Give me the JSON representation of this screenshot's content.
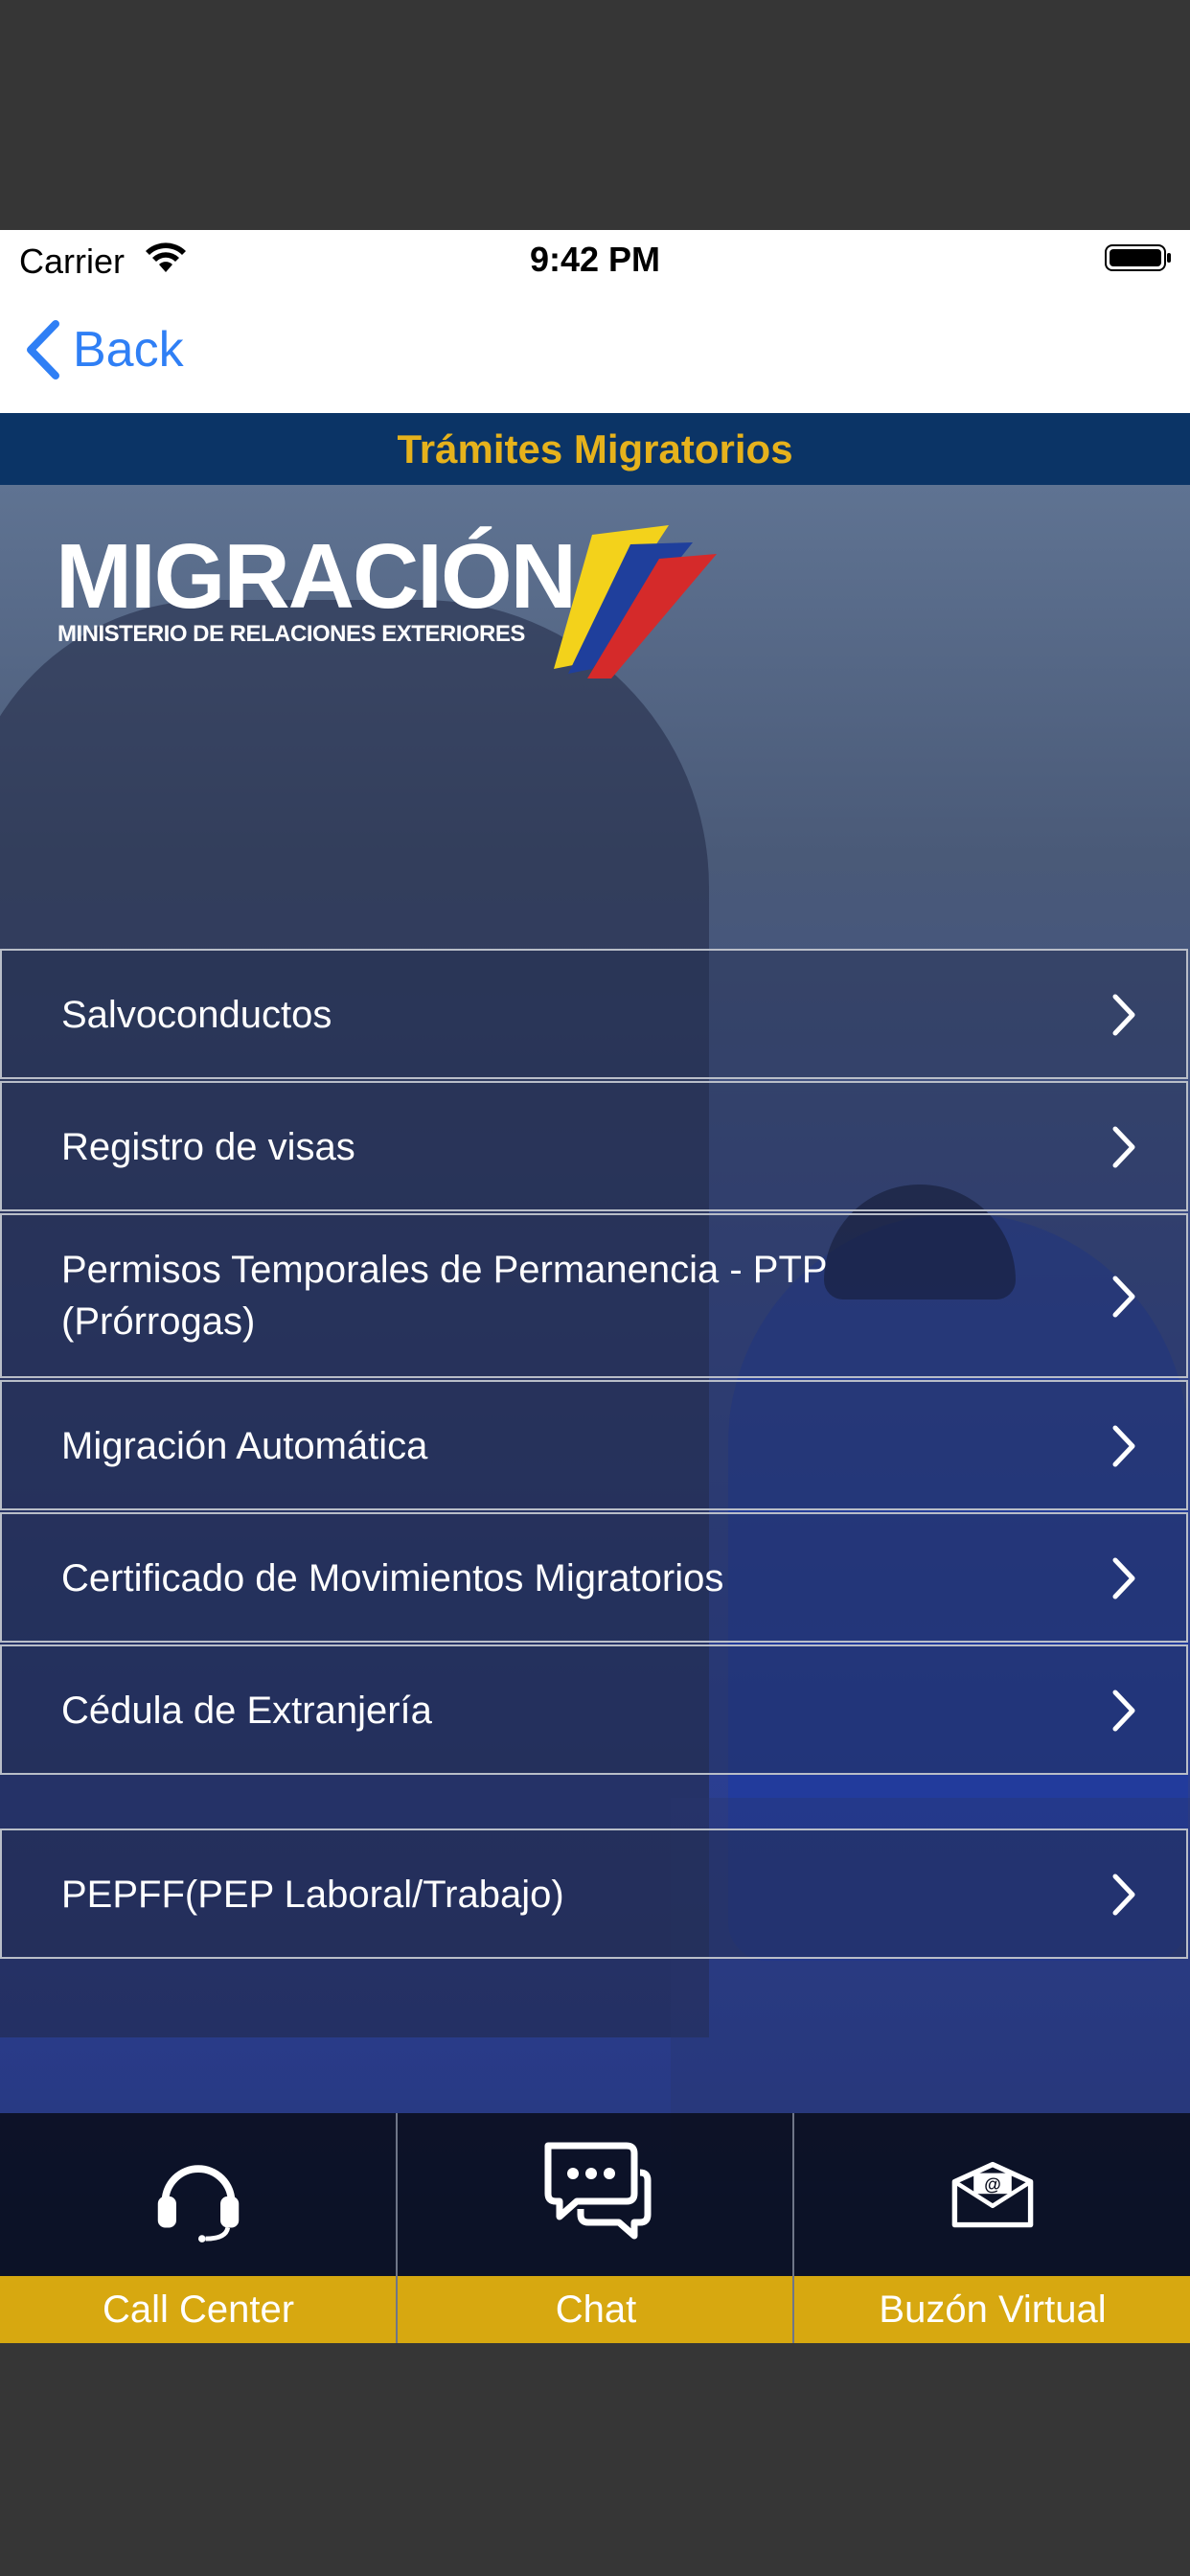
{
  "status_bar": {
    "carrier": "Carrier",
    "time": "9:42 PM"
  },
  "navbar": {
    "back_label": "Back"
  },
  "header": {
    "title": "Trámites Migratorios"
  },
  "logo": {
    "brand": "MIGRACIÓN",
    "subtitle": "MINISTERIO DE RELACIONES EXTERIORES"
  },
  "menu": {
    "items": [
      {
        "label": "Salvoconductos"
      },
      {
        "label": "Registro de visas"
      },
      {
        "label": "Permisos Temporales de Permanencia - PTP",
        "label2": "(Prórrogas)"
      },
      {
        "label": "Migración Automática"
      },
      {
        "label": "Certificado de Movimientos Migratorios"
      },
      {
        "label": "Cédula de Extranjería"
      },
      {
        "label": "PEPFF(PEP Laboral/Trabajo)"
      }
    ]
  },
  "tabbar": {
    "tabs": [
      {
        "label": "Call Center",
        "icon": "headset-icon"
      },
      {
        "label": "Chat",
        "icon": "chat-bubbles-icon"
      },
      {
        "label": "Buzón Virtual",
        "icon": "mail-envelope-icon"
      }
    ]
  },
  "colors": {
    "accent_blue": "#2f7ff5",
    "title_band": "#0b3466",
    "title_text": "#e6b21c",
    "tab_label_bg": "#d7a810"
  }
}
